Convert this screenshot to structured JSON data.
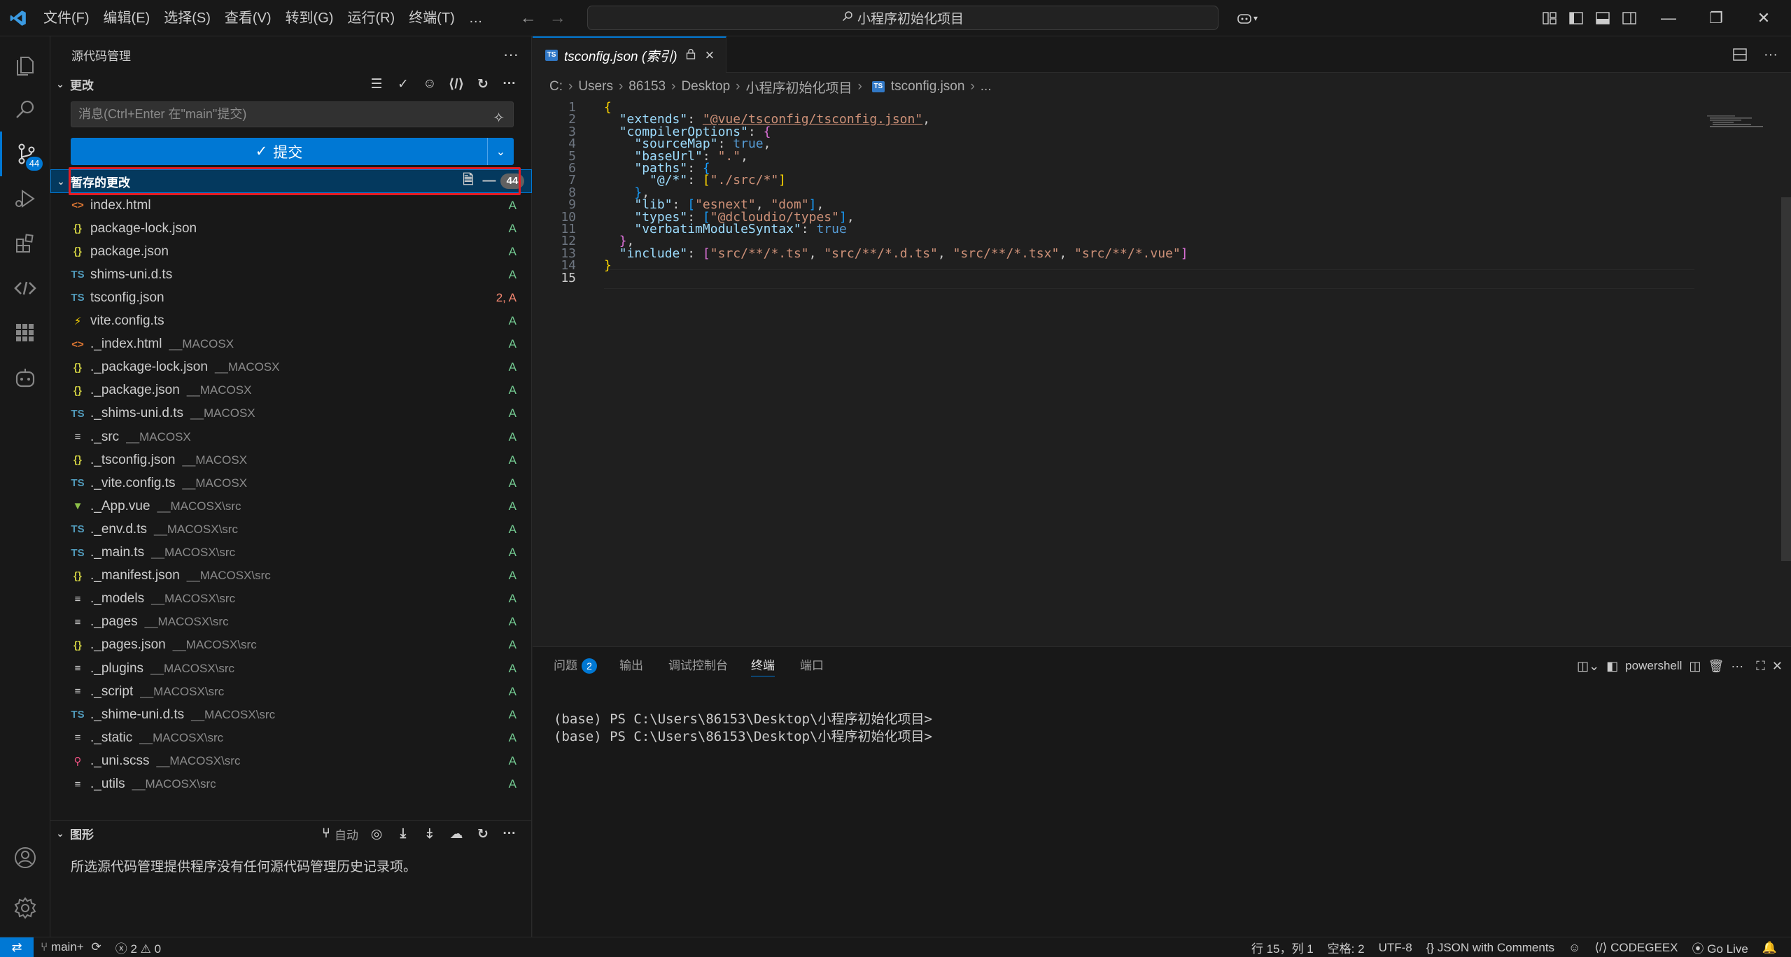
{
  "titlebar": {
    "menus": [
      "文件(F)",
      "编辑(E)",
      "选择(S)",
      "查看(V)",
      "转到(G)",
      "运行(R)",
      "终端(T)",
      "…"
    ],
    "search_text": "小程序初始化项目"
  },
  "activity": {
    "scm_badge": "44"
  },
  "sidebar": {
    "title": "源代码管理",
    "changes_label": "更改",
    "message_placeholder": "消息(Ctrl+Enter 在\"main\"提交)",
    "commit_label": "提交",
    "staged_label": "暂存的更改",
    "staged_count": "44",
    "files": [
      {
        "name": "index.html",
        "path": "",
        "icon": "<>",
        "icon_color": "#e37933",
        "status": "A"
      },
      {
        "name": "package-lock.json",
        "path": "",
        "icon": "{}",
        "icon_color": "#cbcb41",
        "status": "A"
      },
      {
        "name": "package.json",
        "path": "",
        "icon": "{}",
        "icon_color": "#cbcb41",
        "status": "A"
      },
      {
        "name": "shims-uni.d.ts",
        "path": "",
        "icon": "TS",
        "icon_color": "#519aba",
        "status": "A"
      },
      {
        "name": "tsconfig.json",
        "path": "",
        "icon": "TS",
        "icon_color": "#519aba",
        "status": "2, A"
      },
      {
        "name": "vite.config.ts",
        "path": "",
        "icon": "⚡",
        "icon_color": "#ffd700",
        "status": "A"
      },
      {
        "name": "._index.html",
        "path": "__MACOSX",
        "icon": "<>",
        "icon_color": "#e37933",
        "status": "A"
      },
      {
        "name": "._package-lock.json",
        "path": "__MACOSX",
        "icon": "{}",
        "icon_color": "#cbcb41",
        "status": "A"
      },
      {
        "name": "._package.json",
        "path": "__MACOSX",
        "icon": "{}",
        "icon_color": "#cbcb41",
        "status": "A"
      },
      {
        "name": "._shims-uni.d.ts",
        "path": "__MACOSX",
        "icon": "TS",
        "icon_color": "#519aba",
        "status": "A"
      },
      {
        "name": "._src",
        "path": "__MACOSX",
        "icon": "≡",
        "icon_color": "#cccccc",
        "status": "A"
      },
      {
        "name": "._tsconfig.json",
        "path": "__MACOSX",
        "icon": "{}",
        "icon_color": "#cbcb41",
        "status": "A"
      },
      {
        "name": "._vite.config.ts",
        "path": "__MACOSX",
        "icon": "TS",
        "icon_color": "#519aba",
        "status": "A"
      },
      {
        "name": "._App.vue",
        "path": "__MACOSX\\src",
        "icon": "▼",
        "icon_color": "#8dc149",
        "status": "A"
      },
      {
        "name": "._env.d.ts",
        "path": "__MACOSX\\src",
        "icon": "TS",
        "icon_color": "#519aba",
        "status": "A"
      },
      {
        "name": "._main.ts",
        "path": "__MACOSX\\src",
        "icon": "TS",
        "icon_color": "#519aba",
        "status": "A"
      },
      {
        "name": "._manifest.json",
        "path": "__MACOSX\\src",
        "icon": "{}",
        "icon_color": "#cbcb41",
        "status": "A"
      },
      {
        "name": "._models",
        "path": "__MACOSX\\src",
        "icon": "≡",
        "icon_color": "#cccccc",
        "status": "A"
      },
      {
        "name": "._pages",
        "path": "__MACOSX\\src",
        "icon": "≡",
        "icon_color": "#cccccc",
        "status": "A"
      },
      {
        "name": "._pages.json",
        "path": "__MACOSX\\src",
        "icon": "{}",
        "icon_color": "#cbcb41",
        "status": "A"
      },
      {
        "name": "._plugins",
        "path": "__MACOSX\\src",
        "icon": "≡",
        "icon_color": "#cccccc",
        "status": "A"
      },
      {
        "name": "._script",
        "path": "__MACOSX\\src",
        "icon": "≡",
        "icon_color": "#cccccc",
        "status": "A"
      },
      {
        "name": "._shime-uni.d.ts",
        "path": "__MACOSX\\src",
        "icon": "TS",
        "icon_color": "#519aba",
        "status": "A"
      },
      {
        "name": "._static",
        "path": "__MACOSX\\src",
        "icon": "≡",
        "icon_color": "#cccccc",
        "status": "A"
      },
      {
        "name": "._uni.scss",
        "path": "__MACOSX\\src",
        "icon": "⚲",
        "icon_color": "#f55385",
        "status": "A"
      },
      {
        "name": "._utils",
        "path": "__MACOSX\\src",
        "icon": "≡",
        "icon_color": "#cccccc",
        "status": "A"
      }
    ],
    "graph_label": "图形",
    "graph_auto": "自动",
    "graph_empty": "所选源代码管理提供程序没有任何源代码管理历史记录项。"
  },
  "editor": {
    "tab_label": "tsconfig.json (索引)",
    "breadcrumb": [
      "C:",
      "Users",
      "86153",
      "Desktop",
      "小程序初始化项目",
      "tsconfig.json",
      "..."
    ],
    "line_numbers": [
      "1",
      "2",
      "3",
      "4",
      "5",
      "6",
      "7",
      "8",
      "9",
      "10",
      "11",
      "12",
      "13",
      "14",
      "15"
    ],
    "code": {
      "l1": "{",
      "l2_key": "\"extends\"",
      "l2_val": "\"@vue/tsconfig/tsconfig.json\"",
      "l3_key": "\"compilerOptions\"",
      "l4_key": "\"sourceMap\"",
      "l4_val": "true",
      "l5_key": "\"baseUrl\"",
      "l5_val": "\".\"",
      "l6_key": "\"paths\"",
      "l7_key": "\"@/*\"",
      "l7_val": "\"./src/*\"",
      "l9_key": "\"lib\"",
      "l9_v1": "\"esnext\"",
      "l9_v2": "\"dom\"",
      "l10_key": "\"types\"",
      "l10_v1": "\"@dcloudio/types\"",
      "l11_key": "\"verbatimModuleSyntax\"",
      "l11_val": "true",
      "l13_key": "\"include\"",
      "l13_v1": "\"src/**/*.ts\"",
      "l13_v2": "\"src/**/*.d.ts\"",
      "l13_v3": "\"src/**/*.tsx\"",
      "l13_v4": "\"src/**/*.vue\""
    }
  },
  "panel": {
    "tabs": {
      "problems": "问题",
      "problems_badge": "2",
      "output": "输出",
      "debug": "调试控制台",
      "terminal": "终端",
      "ports": "端口"
    },
    "shell": "powershell",
    "terminal_lines": [
      "(base) PS C:\\Users\\86153\\Desktop\\小程序初始化项目>",
      "(base) PS C:\\Users\\86153\\Desktop\\小程序初始化项目>"
    ]
  },
  "statusbar": {
    "branch": "main+",
    "errors": "2",
    "warnings": "0",
    "cursor": "行 15，列 1",
    "spaces": "空格: 2",
    "encoding": "UTF-8",
    "language": "JSON with Comments",
    "codegeex": "CODEGEEX",
    "golive": "Go Live"
  }
}
